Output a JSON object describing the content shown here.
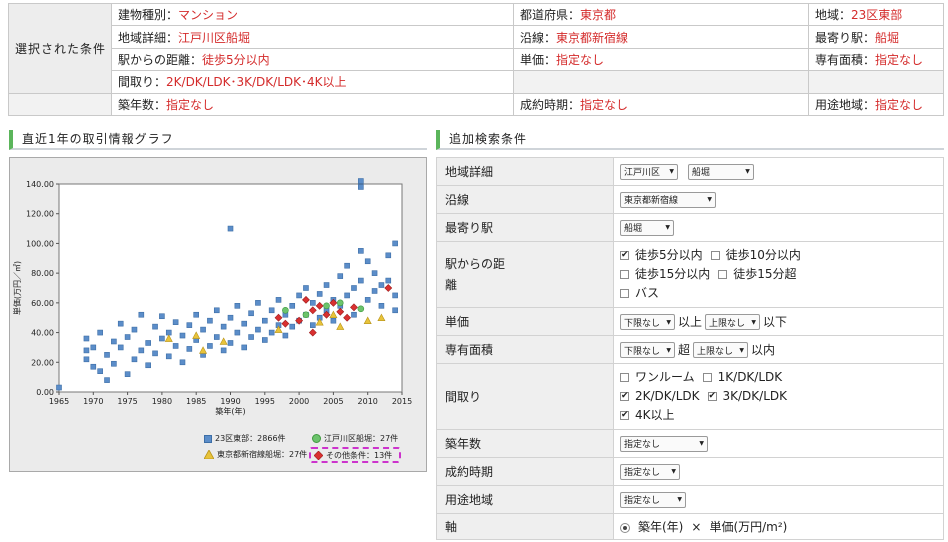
{
  "conditions": {
    "heading": "選択された条件",
    "building_type": {
      "label": "建物種別：",
      "value": "マンション"
    },
    "prefecture": {
      "label": "都道府県：",
      "value": "東京都"
    },
    "region": {
      "label": "地域：",
      "value": "23区東部"
    },
    "area_detail": {
      "label": "地域詳細：",
      "value": "江戸川区船堀"
    },
    "line": {
      "label": "沿線：",
      "value": "東京都新宿線"
    },
    "nearest_station": {
      "label": "最寄り駅：",
      "value": "船堀"
    },
    "distance": {
      "label": "駅からの距離：",
      "value": "徒歩5分以内"
    },
    "unit_price": {
      "label": "単価：",
      "value": "指定なし"
    },
    "floor_area": {
      "label": "専有面積：",
      "value": "指定なし"
    },
    "layout": {
      "label": "間取り：",
      "value": "2K/DK/LDK･3K/DK/LDK･4K以上"
    },
    "age": {
      "label": "築年数：",
      "value": "指定なし"
    },
    "contract_period": {
      "label": "成約時期：",
      "value": "指定なし"
    },
    "zoning": {
      "label": "用途地域：",
      "value": "指定なし"
    }
  },
  "graph": {
    "title": "直近1年の取引情報グラフ",
    "legend": {
      "all": "23区東部：2866件",
      "area": "江戸川区船堀：27件",
      "line": "東京都新宿線船堀：27件",
      "other": "その他条件：13件"
    }
  },
  "chart_data": {
    "type": "scatter",
    "xlabel": "築年(年)",
    "ylabel": "単価(万円／㎡)",
    "xlim": [
      1965,
      2015
    ],
    "ylim": [
      0,
      140
    ],
    "x_ticks": [
      "1965",
      "1970",
      "1975",
      "1980",
      "1985",
      "1990",
      "1995",
      "2000",
      "2005",
      "2010",
      "2015"
    ],
    "y_ticks": [
      "0.00",
      "20.00",
      "40.00",
      "60.00",
      "80.00",
      "100.00",
      "120.00",
      "140.00"
    ],
    "series": [
      {
        "name": "23区東部：2866件",
        "marker": "square",
        "color": "#5b8dc9",
        "points": [
          [
            1965,
            3
          ],
          [
            1969,
            36
          ],
          [
            1969,
            28
          ],
          [
            1969,
            22
          ],
          [
            1970,
            17
          ],
          [
            1970,
            30
          ],
          [
            1971,
            14
          ],
          [
            1971,
            40
          ],
          [
            1972,
            8
          ],
          [
            1972,
            25
          ],
          [
            1973,
            34
          ],
          [
            1973,
            19
          ],
          [
            1974,
            46
          ],
          [
            1974,
            30
          ],
          [
            1975,
            12
          ],
          [
            1975,
            37
          ],
          [
            1976,
            42
          ],
          [
            1976,
            22
          ],
          [
            1977,
            28
          ],
          [
            1977,
            52
          ],
          [
            1978,
            33
          ],
          [
            1978,
            18
          ],
          [
            1979,
            44
          ],
          [
            1979,
            26
          ],
          [
            1980,
            36
          ],
          [
            1980,
            51
          ],
          [
            1981,
            24
          ],
          [
            1981,
            40
          ],
          [
            1982,
            31
          ],
          [
            1982,
            47
          ],
          [
            1983,
            20
          ],
          [
            1983,
            38
          ],
          [
            1984,
            45
          ],
          [
            1984,
            29
          ],
          [
            1985,
            52
          ],
          [
            1985,
            35
          ],
          [
            1986,
            25
          ],
          [
            1986,
            42
          ],
          [
            1987,
            48
          ],
          [
            1987,
            31
          ],
          [
            1988,
            37
          ],
          [
            1988,
            55
          ],
          [
            1989,
            28
          ],
          [
            1989,
            44
          ],
          [
            1990,
            110
          ],
          [
            1990,
            50
          ],
          [
            1990,
            33
          ],
          [
            1991,
            40
          ],
          [
            1991,
            58
          ],
          [
            1992,
            30
          ],
          [
            1992,
            46
          ],
          [
            1993,
            53
          ],
          [
            1993,
            37
          ],
          [
            1994,
            42
          ],
          [
            1994,
            60
          ],
          [
            1995,
            35
          ],
          [
            1995,
            48
          ],
          [
            1996,
            55
          ],
          [
            1996,
            40
          ],
          [
            1997,
            62
          ],
          [
            1997,
            45
          ],
          [
            1998,
            38
          ],
          [
            1998,
            52
          ],
          [
            1999,
            58
          ],
          [
            1999,
            44
          ],
          [
            2000,
            65
          ],
          [
            2000,
            48
          ],
          [
            2001,
            52
          ],
          [
            2001,
            70
          ],
          [
            2002,
            45
          ],
          [
            2002,
            60
          ],
          [
            2003,
            66
          ],
          [
            2003,
            50
          ],
          [
            2004,
            72
          ],
          [
            2004,
            55
          ],
          [
            2005,
            48
          ],
          [
            2005,
            62
          ],
          [
            2006,
            78
          ],
          [
            2006,
            58
          ],
          [
            2007,
            85
          ],
          [
            2007,
            65
          ],
          [
            2008,
            52
          ],
          [
            2008,
            70
          ],
          [
            2009,
            95
          ],
          [
            2009,
            142
          ],
          [
            2009,
            138
          ],
          [
            2009,
            75
          ],
          [
            2010,
            88
          ],
          [
            2010,
            62
          ],
          [
            2011,
            80
          ],
          [
            2011,
            68
          ],
          [
            2012,
            72
          ],
          [
            2012,
            58
          ],
          [
            2013,
            92
          ],
          [
            2013,
            75
          ],
          [
            2014,
            100
          ],
          [
            2014,
            65
          ],
          [
            2014,
            55
          ]
        ]
      },
      {
        "name": "江戸川区船堀：27件",
        "marker": "circle",
        "color": "#6cc36c",
        "points": [
          [
            1998,
            55
          ],
          [
            2001,
            52
          ],
          [
            2004,
            58
          ],
          [
            2006,
            60
          ],
          [
            2009,
            56
          ]
        ]
      },
      {
        "name": "東京都新宿線船堀：27件",
        "marker": "triangle",
        "color": "#e8c33a",
        "points": [
          [
            1981,
            36
          ],
          [
            1985,
            38
          ],
          [
            1986,
            28
          ],
          [
            1989,
            34
          ],
          [
            1997,
            42
          ],
          [
            2003,
            47
          ],
          [
            2005,
            52
          ],
          [
            2006,
            44
          ],
          [
            2010,
            48
          ],
          [
            2012,
            50
          ]
        ]
      },
      {
        "name": "その他条件：13件",
        "marker": "diamond",
        "color": "#d93030",
        "points": [
          [
            1997,
            50
          ],
          [
            1998,
            46
          ],
          [
            2000,
            48
          ],
          [
            2001,
            62
          ],
          [
            2002,
            55
          ],
          [
            2002,
            40
          ],
          [
            2003,
            58
          ],
          [
            2004,
            52
          ],
          [
            2005,
            60
          ],
          [
            2006,
            54
          ],
          [
            2007,
            50
          ],
          [
            2008,
            57
          ],
          [
            2013,
            70
          ]
        ]
      }
    ]
  },
  "search": {
    "title": "追加検索条件",
    "rows": {
      "area_detail": {
        "label": "地域詳細",
        "ward": "江戸川区",
        "town": "船堀"
      },
      "line": {
        "label": "沿線",
        "value": "東京都新宿線"
      },
      "station": {
        "label": "最寄り駅",
        "value": "船堀"
      },
      "distance": {
        "label": "駅からの距離",
        "options": [
          "徒歩5分以内",
          "徒歩10分以内",
          "徒歩15分以内",
          "徒歩15分超",
          "バス"
        ]
      },
      "unit_price": {
        "label": "単価",
        "min": "下限なし",
        "max": "上限なし",
        "above": "以上",
        "below": "以下"
      },
      "floor_area": {
        "label": "専有面積",
        "min": "下限なし",
        "max": "上限なし",
        "sep": "超",
        "below": "以内"
      },
      "layout": {
        "label": "間取り",
        "options": [
          "ワンルーム",
          "1K/DK/LDK",
          "2K/DK/LDK",
          "3K/DK/LDK",
          "4K以上"
        ]
      },
      "age": {
        "label": "築年数",
        "value": "指定なし"
      },
      "contract": {
        "label": "成約時期",
        "value": "指定なし"
      },
      "zoning": {
        "label": "用途地域",
        "value": "指定なし"
      },
      "axis": {
        "label": "軸",
        "x": "築年(年)",
        "times": "×",
        "y": "単価(万円/m²)"
      }
    }
  }
}
